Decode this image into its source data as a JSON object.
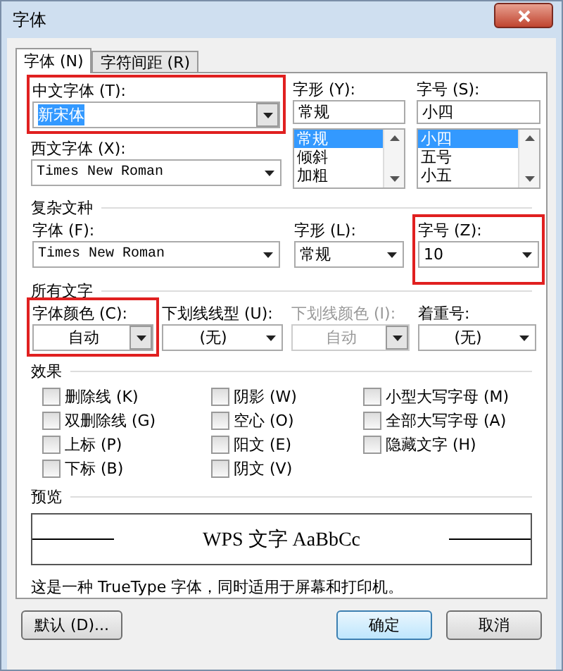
{
  "window": {
    "title": "字体"
  },
  "tabs": [
    {
      "label": "字体 (N)",
      "selected": true
    },
    {
      "label": "字符间距 (R)",
      "selected": false
    }
  ],
  "chinese_font": {
    "label": "中文字体 (T):",
    "value": "新宋体",
    "highlighted": true
  },
  "style": {
    "label": "字形 (Y):",
    "value": "常规",
    "options": [
      {
        "label": "常规",
        "selected": true
      },
      {
        "label": "倾斜",
        "selected": false
      },
      {
        "label": "加粗",
        "selected": false
      }
    ]
  },
  "size": {
    "label": "字号 (S):",
    "value": "小四",
    "options": [
      {
        "label": "小四",
        "selected": true
      },
      {
        "label": "五号",
        "selected": false
      },
      {
        "label": "小五",
        "selected": false
      }
    ]
  },
  "western_font": {
    "label": "西文字体 (X):",
    "value": "Times New Roman"
  },
  "complex": {
    "title": "复杂文种",
    "fields": [
      {
        "label": "字体 (F):",
        "value": "Times New Roman",
        "latin": true,
        "highlighted": false
      },
      {
        "label": "字形 (L):",
        "value": "常规",
        "latin": false,
        "highlighted": false
      },
      {
        "label": "字号 (Z):",
        "value": "10",
        "latin": false,
        "highlighted": true
      }
    ]
  },
  "all_text": {
    "title": "所有文字",
    "fields": [
      {
        "label": "字体颜色 (C):",
        "value": "自动",
        "kind": "color",
        "disabled": false,
        "highlighted": true
      },
      {
        "label": "下划线线型 (U):",
        "value": "(无)",
        "kind": "dropdown",
        "disabled": false,
        "highlighted": false
      },
      {
        "label": "下划线颜色 (I):",
        "value": "自动",
        "kind": "color",
        "disabled": true,
        "highlighted": false
      },
      {
        "label": "着重号:",
        "value": "(无)",
        "kind": "dropdown",
        "disabled": false,
        "highlighted": false
      }
    ]
  },
  "effects": {
    "title": "效果",
    "options": [
      {
        "label": "删除线 (K)",
        "checked": false
      },
      {
        "label": "双删除线 (G)",
        "checked": false
      },
      {
        "label": "上标 (P)",
        "checked": false
      },
      {
        "label": "下标 (B)",
        "checked": false
      },
      {
        "label": "阴影 (W)",
        "checked": false
      },
      {
        "label": "空心 (O)",
        "checked": false
      },
      {
        "label": "阳文 (E)",
        "checked": false
      },
      {
        "label": "阴文 (V)",
        "checked": false
      },
      {
        "label": "小型大写字母 (M)",
        "checked": false
      },
      {
        "label": "全部大写字母 (A)",
        "checked": false
      },
      {
        "label": "隐藏文字 (H)",
        "checked": false
      }
    ]
  },
  "preview": {
    "title": "预览",
    "sample": "WPS 文字 AaBbCc"
  },
  "description": "这是一种 TrueType 字体，同时适用于屏幕和打印机。",
  "buttons": [
    {
      "label": "默认 (D)...",
      "kind": "default"
    },
    {
      "label": "确定",
      "kind": "primary"
    },
    {
      "label": "取消",
      "kind": "secondary"
    }
  ]
}
